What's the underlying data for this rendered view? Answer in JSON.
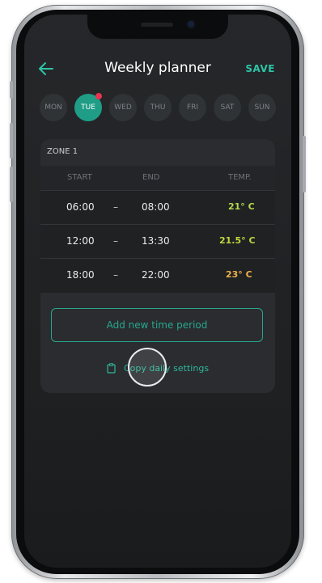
{
  "header": {
    "title": "Weekly planner",
    "save_label": "SAVE",
    "back_icon": "arrow-left-icon"
  },
  "days": [
    {
      "label": "MON",
      "active": false
    },
    {
      "label": "TUE",
      "active": true,
      "indicator": "#e8344f"
    },
    {
      "label": "WED",
      "active": false
    },
    {
      "label": "THU",
      "active": false
    },
    {
      "label": "FRI",
      "active": false
    },
    {
      "label": "SAT",
      "active": false
    },
    {
      "label": "SUN",
      "active": false
    }
  ],
  "zone": {
    "title": "ZONE 1",
    "columns": {
      "start": "START",
      "end": "END",
      "temp": "TEMP."
    },
    "periods": [
      {
        "start": "06:00",
        "separator": "–",
        "end": "08:00",
        "temp": "21° C",
        "temp_color": "#b6d84a"
      },
      {
        "start": "12:00",
        "separator": "–",
        "end": "13:30",
        "temp": "21.5° C",
        "temp_color": "#c2d63c"
      },
      {
        "start": "18:00",
        "separator": "–",
        "end": "22:00",
        "temp": "23° C",
        "temp_color": "#f0b04a"
      }
    ]
  },
  "actions": {
    "add_period_label": "Add new time period",
    "copy_label": "Copy daily settings",
    "copy_icon": "clipboard-icon"
  },
  "colors": {
    "accent": "#2ec4a6",
    "active_day": "#1f9d86",
    "background": "#1f2123",
    "card": "#2a2c2f"
  }
}
